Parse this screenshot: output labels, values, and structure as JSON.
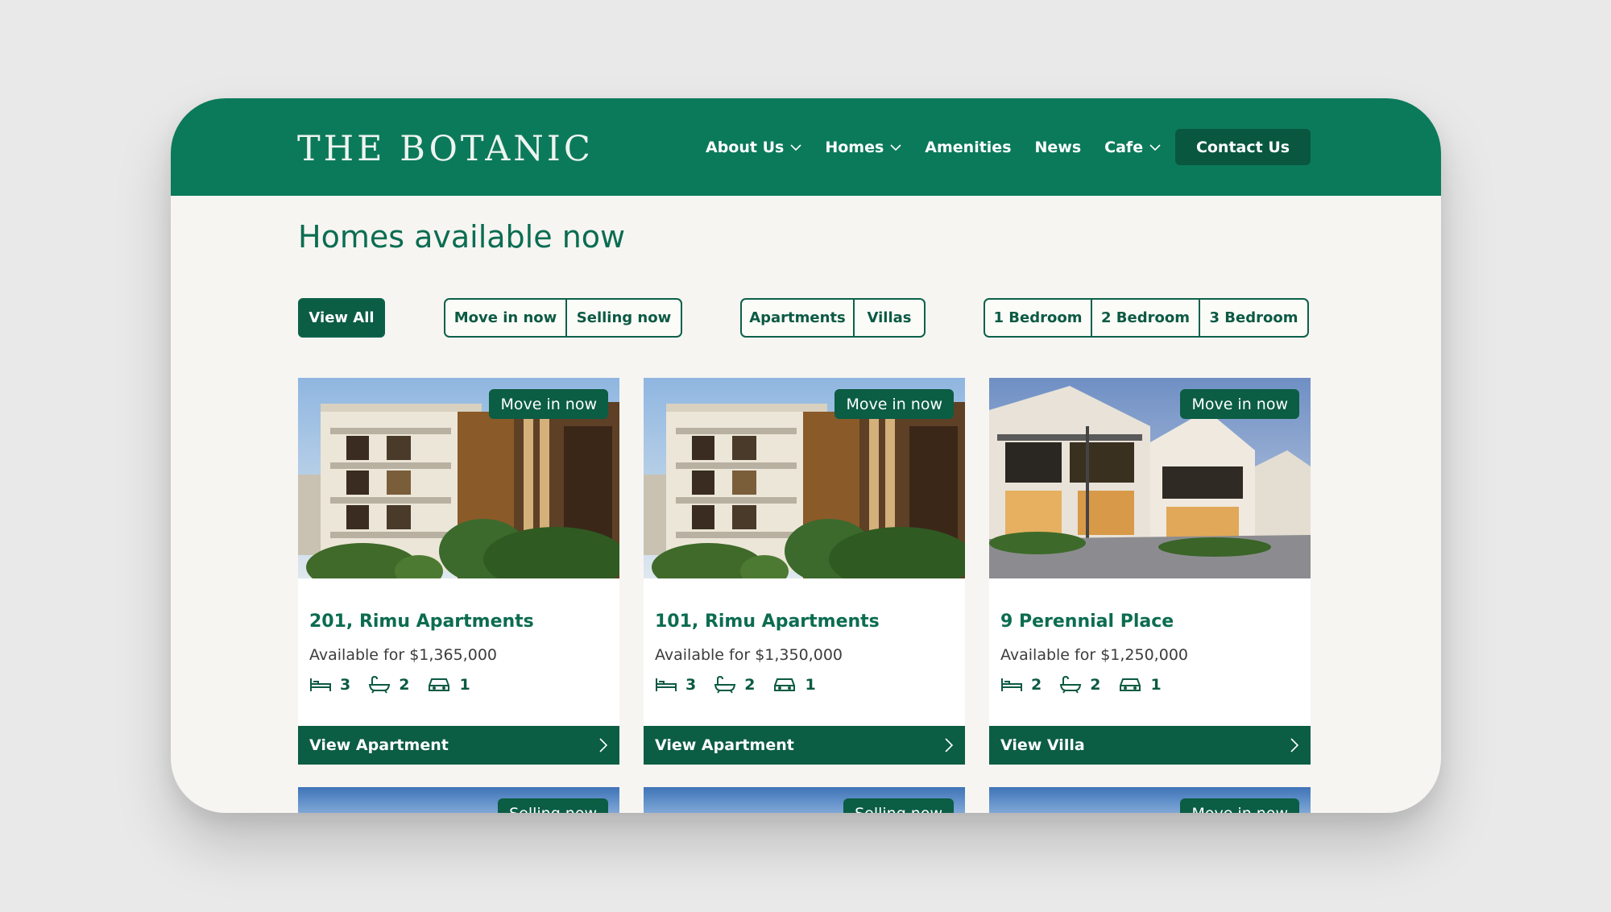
{
  "brand": {
    "logo": "THE BOTANIC"
  },
  "nav": {
    "items": [
      {
        "label": "About Us",
        "has_dropdown": true
      },
      {
        "label": "Homes",
        "has_dropdown": true
      },
      {
        "label": "Amenities",
        "has_dropdown": false
      },
      {
        "label": "News",
        "has_dropdown": false
      },
      {
        "label": "Cafe",
        "has_dropdown": true
      }
    ],
    "contact_label": "Contact Us"
  },
  "page": {
    "title": "Homes available now"
  },
  "filters": {
    "view_all": "View All",
    "status": [
      "Move in now",
      "Selling now"
    ],
    "type": [
      "Apartments",
      "Villas"
    ],
    "bedrooms": [
      "1 Bedroom",
      "2 Bedroom",
      "3 Bedroom"
    ]
  },
  "listings": [
    {
      "badge": "Move in now",
      "title": "201, Rimu Apartments",
      "price": "Available for $1,365,000",
      "beds": "3",
      "baths": "2",
      "cars": "1",
      "cta": "View Apartment",
      "image": "apartment-building-photo"
    },
    {
      "badge": "Move in now",
      "title": "101, Rimu Apartments",
      "price": "Available for $1,350,000",
      "beds": "3",
      "baths": "2",
      "cars": "1",
      "cta": "View Apartment",
      "image": "apartment-building-photo"
    },
    {
      "badge": "Move in now",
      "title": "9 Perennial Place",
      "price": "Available for $1,250,000",
      "beds": "2",
      "baths": "2",
      "cars": "1",
      "cta": "View Villa",
      "image": "villa-photo"
    }
  ],
  "next_row_badges": [
    "Selling now",
    "Selling now",
    "Move in now"
  ],
  "colors": {
    "brand_green": "#0b7a5a",
    "dark_green": "#0b5d44",
    "page_bg": "#f6f5f2"
  }
}
